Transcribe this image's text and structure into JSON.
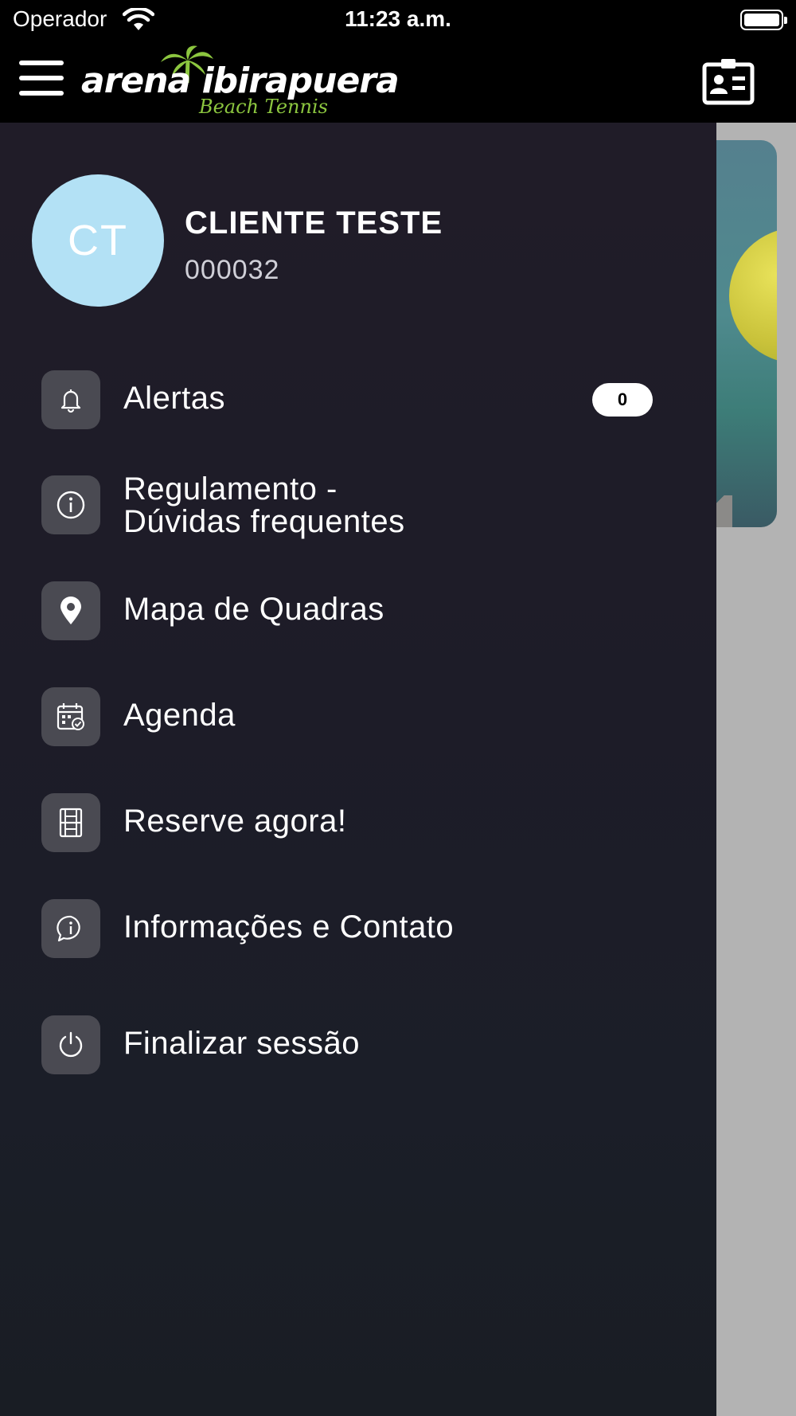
{
  "status_bar": {
    "carrier": "Operador",
    "time": "11:23 a.m."
  },
  "header": {
    "logo_main": "arena ibirapuera",
    "logo_sub": "Beach Tennis"
  },
  "profile": {
    "initials": "CT",
    "name": "CLIENTE TESTE",
    "code": "000032"
  },
  "menu": {
    "items": [
      {
        "label": "Alertas",
        "icon": "bell-icon",
        "badge": "0"
      },
      {
        "label_line1": "Regulamento -",
        "label_line2": "Dúvidas frequentes",
        "icon": "info-icon"
      },
      {
        "label": "Mapa de Quadras",
        "icon": "location-pin-icon"
      },
      {
        "label": "Agenda",
        "icon": "calendar-check-icon"
      },
      {
        "label": "Reserve agora!",
        "icon": "court-icon"
      },
      {
        "label": "Informações e Contato",
        "icon": "chat-info-icon"
      },
      {
        "label": "Finalizar sessão",
        "icon": "power-icon"
      }
    ]
  },
  "colors": {
    "drawer_bg": "#1e1c28",
    "avatar_bg": "#b3e1f5",
    "icon_tile": "#4a4a52",
    "logo_green": "#8cc63f"
  }
}
